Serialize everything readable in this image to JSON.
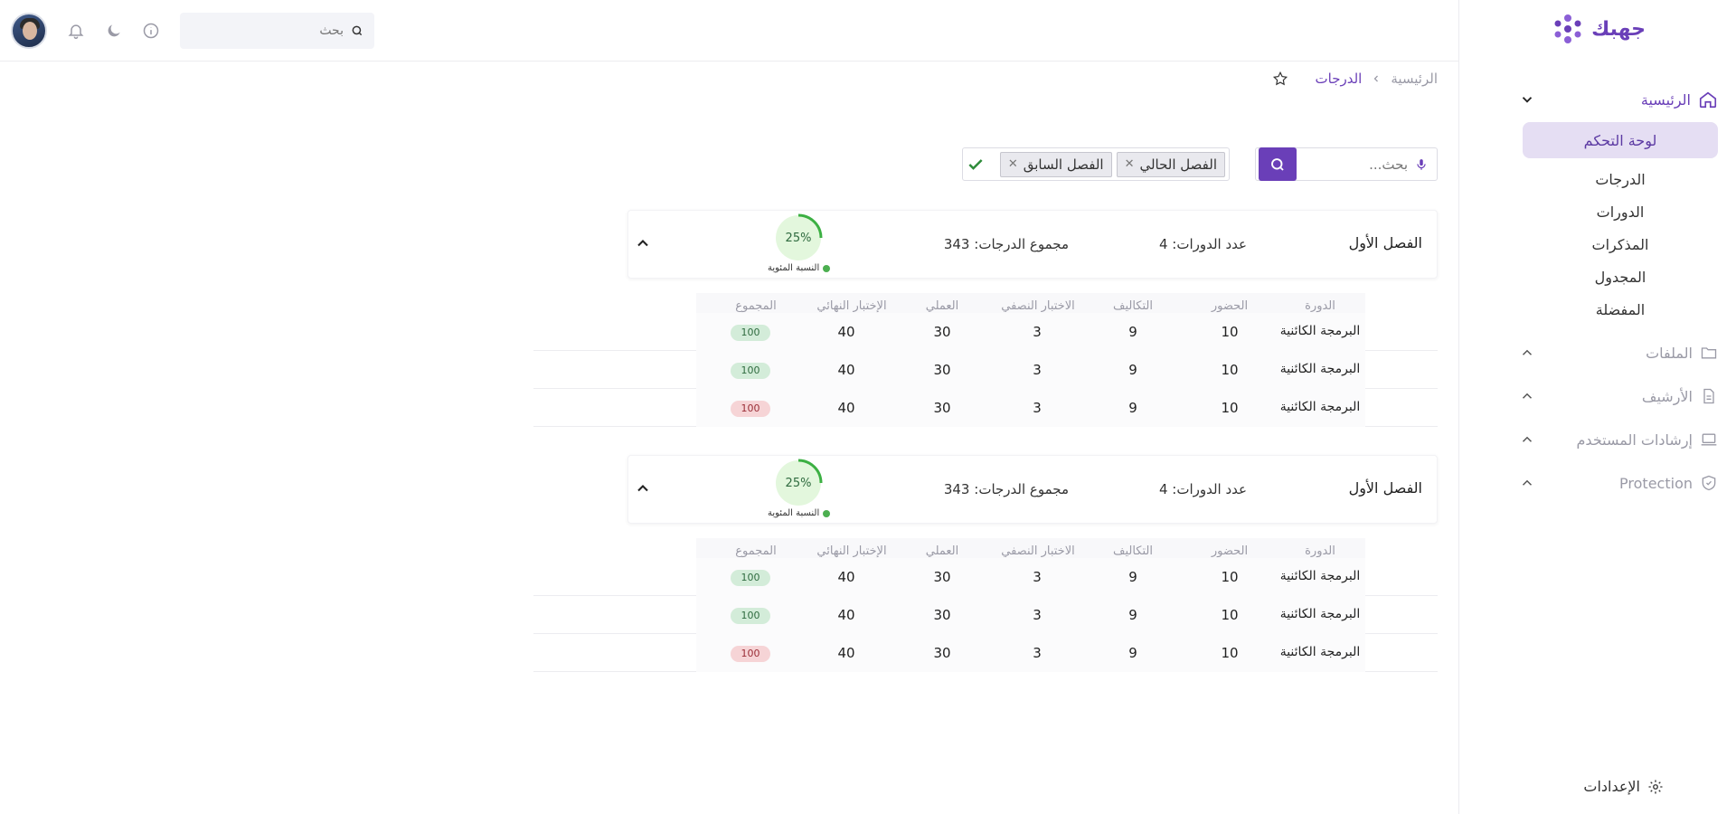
{
  "app": {
    "logo_text": "جهبك",
    "brand_color": "#6a3fb8"
  },
  "topbar": {
    "search_placeholder": "بحث"
  },
  "sidebar": {
    "home_label": "الرئيسية",
    "sub_items": [
      {
        "label": "لوحة التحكم",
        "active": true
      },
      {
        "label": "الدرجات"
      },
      {
        "label": "الدورات"
      },
      {
        "label": "المذكرات"
      },
      {
        "label": "المجدول"
      },
      {
        "label": "المفضلة"
      }
    ],
    "groups": [
      {
        "label": "الملفات",
        "icon": "folder-icon"
      },
      {
        "label": "الأرشيف",
        "icon": "document-icon"
      },
      {
        "label": "إرشادات المستخدم",
        "icon": "laptop-icon"
      },
      {
        "label": "Protection",
        "icon": "shield-icon"
      }
    ],
    "settings_label": "الإعدادات"
  },
  "breadcrumb": {
    "home": "الرئيسية",
    "current": "الدرجات"
  },
  "filter": {
    "search_placeholder": "بحث...",
    "chips": [
      "الفصل الحالي",
      "الفصل  السابق"
    ]
  },
  "table_headers": [
    "الدورة",
    "الحضور",
    "التكاليف",
    "الاختبار النصفي",
    "العملي",
    "الإختبار النهائي",
    "المجموع"
  ],
  "semesters": [
    {
      "title": "الفصل الأول",
      "course_count": "عدد الدورات: 4",
      "total_label": "مجموع الدرجات:",
      "total_value": "343",
      "percent": "25%",
      "percent_value": 0.25,
      "percent_label": "النسبة المئوية",
      "rows": [
        {
          "course": "البرمجة الكائنية",
          "attendance": "10",
          "assignments": "9",
          "midterm": "3",
          "practical": "30",
          "final": "40",
          "total": "100",
          "status": "ok"
        },
        {
          "course": "البرمجة الكائنية",
          "attendance": "10",
          "assignments": "9",
          "midterm": "3",
          "practical": "30",
          "final": "40",
          "total": "100",
          "status": "ok"
        },
        {
          "course": "البرمجة الكائنية",
          "attendance": "10",
          "assignments": "9",
          "midterm": "3",
          "practical": "30",
          "final": "40",
          "total": "100",
          "status": "bad"
        }
      ]
    },
    {
      "title": "الفصل الأول",
      "course_count": "عدد الدورات: 4",
      "total_label": "مجموع الدرجات:",
      "total_value": "343",
      "percent": "25%",
      "percent_value": 0.25,
      "percent_label": "النسبة المئوية",
      "rows": [
        {
          "course": "البرمجة الكائنية",
          "attendance": "10",
          "assignments": "9",
          "midterm": "3",
          "practical": "30",
          "final": "40",
          "total": "100",
          "status": "ok"
        },
        {
          "course": "البرمجة الكائنية",
          "attendance": "10",
          "assignments": "9",
          "midterm": "3",
          "practical": "30",
          "final": "40",
          "total": "100",
          "status": "ok"
        },
        {
          "course": "البرمجة الكائنية",
          "attendance": "10",
          "assignments": "9",
          "midterm": "3",
          "practical": "30",
          "final": "40",
          "total": "100",
          "status": "bad"
        }
      ]
    }
  ]
}
